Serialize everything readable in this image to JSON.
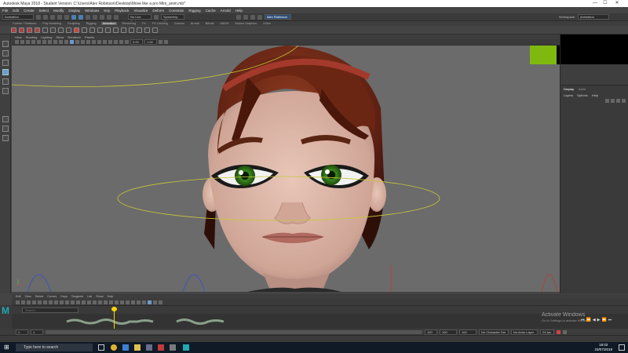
{
  "window": {
    "title": "Autodesk Maya 2018 - Student Version: C:\\Users\\Alex Robinson\\Desktop\\Move like a pro Mini_anim.mb*",
    "min": "—",
    "max": "☐",
    "close": "✕"
  },
  "menubar": [
    "File",
    "Edit",
    "Create",
    "Select",
    "Modify",
    "Display",
    "Windows",
    "Key",
    "Playback",
    "Visualize",
    "Deform",
    "Constrain",
    "Rigging",
    "Cache",
    "Arnold",
    "Help"
  ],
  "statusline": {
    "mode": "Animation",
    "live_surface": "No Live Surface",
    "symmetry": "Symmetry: Off",
    "user": "Alex Robinson",
    "workspace_label": "Workspace:",
    "workspace": "Animation"
  },
  "shelf_tabs": [
    "Curves / Surfaces",
    "Poly Modeling",
    "Sculpting",
    "Rigging",
    "Animation",
    "Rendering",
    "FX",
    "FX Caching",
    "Custom",
    "Arnold",
    "Bifrost",
    "MASH",
    "Motion Graphics",
    "XGen"
  ],
  "shelf_active": "Animation",
  "panel_menu": [
    "View",
    "Shading",
    "Lighting",
    "Show",
    "Renderer",
    "Panels"
  ],
  "panel_fields": {
    "a": "0.00",
    "b": "1.00"
  },
  "right_panel": {
    "tabs": [
      "Display",
      "Anim"
    ],
    "menu": [
      "Layers",
      "Options",
      "Help"
    ]
  },
  "timeline_menu": [
    "Edit",
    "View",
    "Select",
    "Curves",
    "Keys",
    "Tangents",
    "List",
    "Show",
    "Help"
  ],
  "timeline": {
    "search_placeholder": "Search...",
    "watermark_title": "Activate Windows",
    "watermark_sub": "Go to Settings to activate Windows.",
    "current_frame": "1"
  },
  "bottombar": {
    "start": "1",
    "range_start": "1",
    "range_end": "100",
    "end": "100",
    "end2": "100",
    "character_set": "No Character Set",
    "anim_layer": "No Anim Layer",
    "fps": "24 fps"
  },
  "taskbar": {
    "search_placeholder": "Type here to search",
    "time": "18:02",
    "date": "23/07/2019"
  },
  "colors": {
    "accent_green": "#7fb80e",
    "viewport_bg": "#6b6b6b",
    "timeline_playhead": "#ffd400"
  }
}
